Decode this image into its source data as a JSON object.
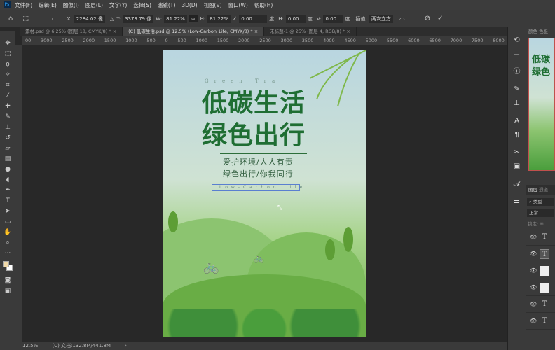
{
  "menu": [
    "文件(F)",
    "编辑(E)",
    "图像(I)",
    "图层(L)",
    "文字(Y)",
    "选择(S)",
    "滤镜(T)",
    "3D(D)",
    "视图(V)",
    "窗口(W)",
    "帮助(H)"
  ],
  "options": {
    "x_label": "X:",
    "x": "2284.02 像",
    "y_label": "Y:",
    "y": "3373.79 像",
    "w_label": "W:",
    "w": "81.22%",
    "h_label": "H:",
    "h": "81.22%",
    "angle": "0.00",
    "angle_unit": "度",
    "hskew_label": "H:",
    "hskew": "0.00",
    "hskew_unit": "度",
    "vskew_label": "V:",
    "vskew": "0.00",
    "vskew_unit": "度",
    "interp_label": "插值:",
    "interp": "两次立方"
  },
  "tabs": [
    {
      "label": "素材.psd @ 6.25% (图层 18, CMYK/8) *"
    },
    {
      "label": "(C) 低碳生活.psd @ 12.5% (Low-Carbon_Life, CMYK/8) *"
    },
    {
      "label": "未标题-1 @ 25% (图层 4, RGB/8) *"
    }
  ],
  "ruler": [
    "00",
    "3000",
    "2500",
    "2000",
    "1500",
    "1000",
    "500",
    "0",
    "500",
    "1000",
    "1500",
    "2000",
    "2500",
    "3000",
    "3500",
    "4000",
    "4500",
    "5000",
    "5500",
    "6000",
    "6500",
    "7000",
    "7500",
    "8000"
  ],
  "poster": {
    "eyebrow": "Green  Tra",
    "title1": "低碳生活",
    "title2": "绿色出行",
    "sub1": "爱护环境/人人有责",
    "sub2": "绿色出行/你我同行",
    "selected_text": "Low-Carbon  Life"
  },
  "status": {
    "zoom": "12.5%",
    "doc": "(C) 文档:132.8M/441.8M"
  },
  "panel": {
    "tab_color": "颜色",
    "tab_swatch": "色板",
    "tab_layers": "图层",
    "tab_channels": "通道",
    "filter": "类型",
    "blend": "正常",
    "lock": "锁定:"
  },
  "colors": {
    "title_green": "#1f6e33",
    "accent": "#31a8ff"
  }
}
